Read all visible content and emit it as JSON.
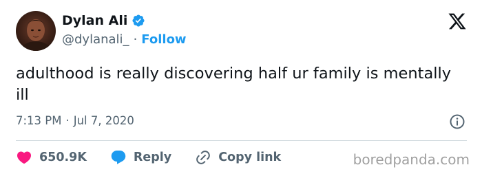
{
  "author": {
    "display_name": "Dylan Ali",
    "handle": "@dylanali_",
    "follow_label": "Follow",
    "separator": "·"
  },
  "tweet": {
    "text": "adulthood is really discovering half ur family is mentally ill",
    "time": "7:13 PM",
    "date": "Jul 7, 2020",
    "separator": "·"
  },
  "actions": {
    "likes": "650.9K",
    "reply_label": "Reply",
    "copy_link_label": "Copy link"
  },
  "watermark": "boredpanda.com",
  "colors": {
    "accent": "#1d9bf0",
    "like": "#f91880",
    "text": "#0f1419",
    "muted": "#536471"
  },
  "icons": {
    "verified": "verified-badge-icon",
    "x": "x-logo-icon",
    "info": "info-icon",
    "like": "heart-icon",
    "reply": "reply-bubble-icon",
    "copy_link": "link-icon"
  }
}
